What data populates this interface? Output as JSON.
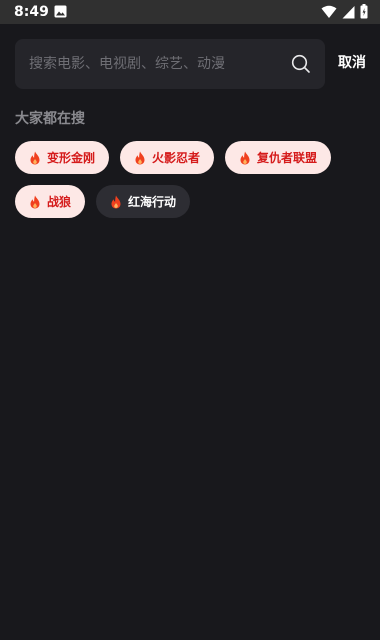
{
  "status_bar": {
    "time": "8:49",
    "icons": [
      "image-icon",
      "wifi-icon",
      "signal-icon",
      "battery-icon"
    ]
  },
  "search": {
    "placeholder": "搜索电影、电视剧、综艺、动漫",
    "value": "",
    "cancel_label": "取消"
  },
  "hot_section": {
    "title": "大家都在搜",
    "items": [
      {
        "label": "变形金刚",
        "icon": "flame-icon"
      },
      {
        "label": "火影忍者",
        "icon": "flame-icon"
      },
      {
        "label": "复仇者联盟",
        "icon": "flame-icon"
      },
      {
        "label": "战狼",
        "icon": "flame-icon"
      },
      {
        "label": "红海行动",
        "icon": "flame-icon"
      }
    ]
  },
  "colors": {
    "background": "#18181c",
    "hot_chip_background": "#fde8e6",
    "hot_chip_text": "#d51b1b",
    "dark_chip_background": "#2d2d33",
    "flame": "#f0401f"
  }
}
